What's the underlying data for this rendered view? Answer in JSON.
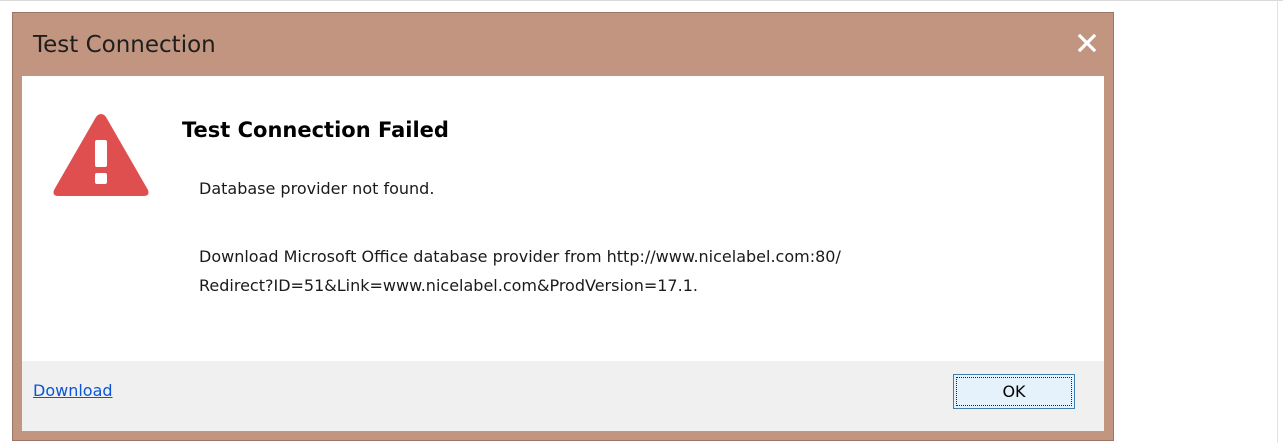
{
  "dialog": {
    "title": "Test Connection",
    "close_icon": "close-icon",
    "frame_color": "#c19580",
    "heading": "Test Connection Failed",
    "warning_icon": "warning-triangle-icon",
    "warning_color": "#e04f4f",
    "message_line1": "Database provider not found.",
    "message_line2a": "Download Microsoft Office database provider from http://www.nicelabel.com:80/",
    "message_line2b": "Redirect?ID=51&Link=www.nicelabel.com&ProdVersion=17.1.",
    "download_link": "Download",
    "ok_label": "OK"
  }
}
